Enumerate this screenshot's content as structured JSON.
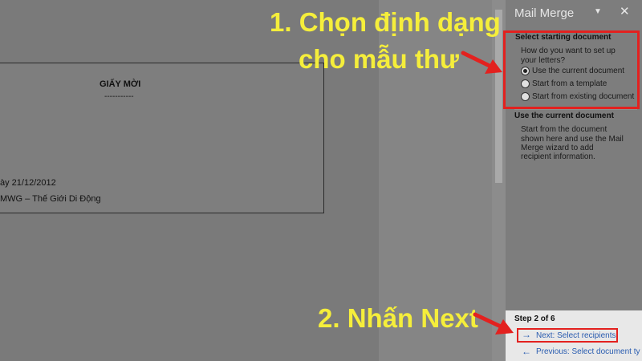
{
  "document": {
    "title": "GIẤY MỜI",
    "title_underline": "-----------",
    "date_line": "ày 21/12/2012",
    "company_line": "MWG – Thế Giới Di Động"
  },
  "panel": {
    "title": "Mail Merge",
    "select_heading": "Select starting document",
    "question_line1": "How do you want to set up",
    "question_line2": "your letters?",
    "options": [
      {
        "label": "Use the current document",
        "selected": true
      },
      {
        "label": "Start from a template",
        "selected": false
      },
      {
        "label": "Start from existing document",
        "selected": false
      }
    ],
    "info_heading": "Use the current document",
    "info_lines": [
      "Start from the document",
      "shown here and use the Mail",
      "Merge wizard to add",
      "recipient information."
    ],
    "step_label": "Step 2 of 6",
    "next_link": "Next: Select recipients",
    "previous_link": "Previous: Select document ty"
  },
  "annotations": {
    "step1_line1": "1. Chọn định dạng",
    "step1_line2": "cho mẫu thư",
    "step2": "2. Nhấn Next"
  },
  "colors": {
    "highlight": "#e3211f",
    "annotation_text": "#f5ee3b",
    "link": "#2a5db0"
  }
}
